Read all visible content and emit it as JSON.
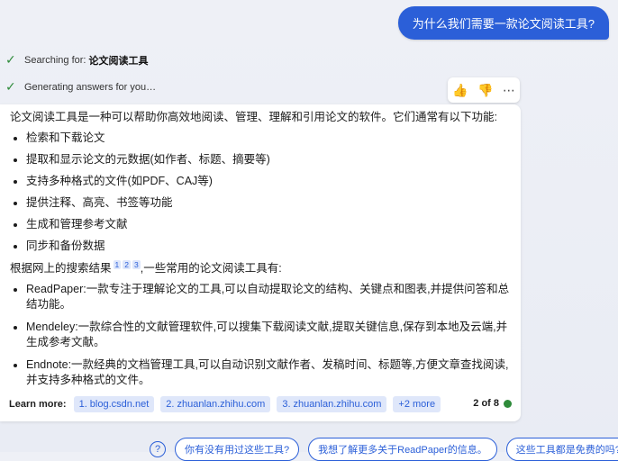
{
  "user_message": "为什么我们需要一款论文阅读工具?",
  "status": [
    {
      "prefix": "Searching for: ",
      "query": "论文阅读工具"
    },
    {
      "prefix": "Generating answers for you…",
      "query": ""
    }
  ],
  "answer": {
    "intro": "论文阅读工具是一种可以帮助你高效地阅读、管理、理解和引用论文的软件。它们通常有以下功能:",
    "features": [
      "检索和下载论文",
      "提取和显示论文的元数据(如作者、标题、摘要等)",
      "支持多种格式的文件(如PDF、CAJ等)",
      "提供注释、高亮、书签等功能",
      "生成和管理参考文献",
      "同步和备份数据"
    ],
    "search_lead": "根据网上的搜索结果",
    "citations": [
      "1",
      "2",
      "3"
    ],
    "search_tail": ",一些常用的论文阅读工具有:",
    "tools": [
      "ReadPaper:一款专注于理解论文的工具,可以自动提取论文的结构、关键点和图表,并提供问答和总结功能。",
      "Mendeley:一款综合性的文献管理软件,可以搜集下载阅读文献,提取关键信息,保存到本地及云端,并生成参考文献。",
      "Endnote:一款经典的文档管理工具,可以自动识别文献作者、发稿时间、标题等,方便文章查找阅读,并支持多种格式的文件。"
    ]
  },
  "learn_more": {
    "label": "Learn more:",
    "links": [
      "1. blog.csdn.net",
      "2. zhuanlan.zhihu.com",
      "3. zhuanlan.zhihu.com",
      "+2 more"
    ]
  },
  "pager": "2 of 8",
  "suggestions": [
    "你有没有用过这些工具?",
    "我想了解更多关于ReadPaper的信息。",
    "这些工具都是免费的吗?"
  ],
  "icons": {
    "like": "thumbs-up-icon",
    "dislike": "thumbs-down-icon",
    "more": "more-icon",
    "check": "check-icon",
    "help": "help-icon"
  },
  "colors": {
    "accent": "#2b5fd8",
    "success": "#2e8b3a"
  }
}
